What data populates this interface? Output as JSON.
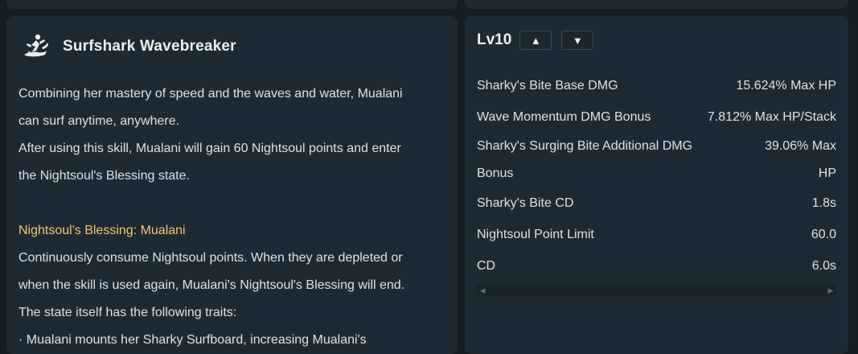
{
  "skill": {
    "icon": "surfing-shark-icon",
    "title": "Surfshark Wavebreaker",
    "desc_line1": "Combining her mastery of speed and the waves and water, Mualani",
    "desc_line2": "can surf anytime, anywhere.",
    "desc_line3": "After using this skill, Mualani will gain 60 Nightsoul points and enter",
    "desc_line4": "the Nightsoul's Blessing state.",
    "highlight_heading": "Nightsoul's Blessing: Mualani",
    "desc_line5": "Continuously consume Nightsoul points. When they are depleted or",
    "desc_line6": "when the skill is used again, Mualani's Nightsoul's Blessing will end.",
    "desc_line7": "The state itself has the following traits:",
    "desc_line8": "· Mualani mounts her Sharky Surfboard, increasing Mualani's"
  },
  "stats": {
    "level_label": "Lv10",
    "level_up_glyph": "▲",
    "level_down_glyph": "▼",
    "rows": [
      {
        "label": "Sharky's Bite Base DMG",
        "value": "15.624% Max HP"
      },
      {
        "label": "Wave Momentum DMG Bonus",
        "value": "7.812% Max HP/Stack"
      },
      {
        "label": "Sharky's Surging Bite Additional DMG",
        "value": "39.06% Max",
        "label_cont": "Bonus",
        "value_cont": "HP"
      },
      {
        "label": "Sharky's Bite CD",
        "value": "1.8s"
      },
      {
        "label": "Nightsoul Point Limit",
        "value": "60.0"
      },
      {
        "label": "CD",
        "value": "6.0s"
      }
    ],
    "scroll_left_glyph": "◀",
    "scroll_right_glyph": "▶"
  },
  "colors": {
    "panel_bg": "#1e2a33",
    "page_bg": "#151c22",
    "highlight": "#f4c56a",
    "text": "#dde2e6"
  }
}
